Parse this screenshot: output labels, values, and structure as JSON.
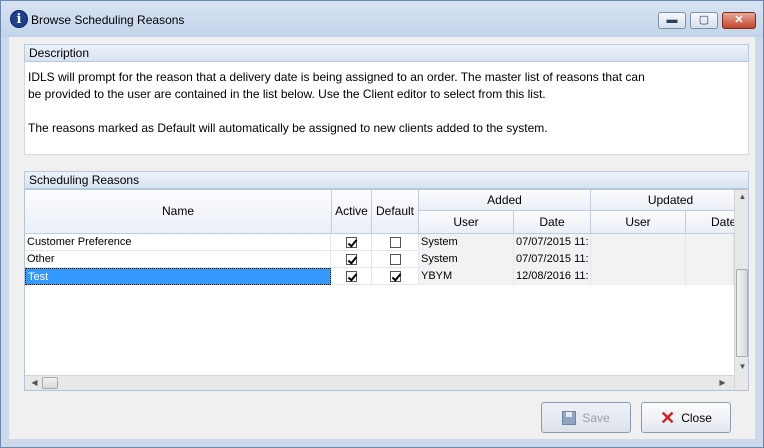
{
  "window": {
    "title": "Browse Scheduling Reasons",
    "app_icon_glyph": "i",
    "controls": {
      "minimize": "▬",
      "maximize": "▢",
      "close": "✕"
    }
  },
  "description": {
    "header": "Description",
    "lines": [
      "IDLS will prompt for the reason that a delivery date is being assigned to an order.  The master list of reasons that can",
      "be provided to the user are contained in the list below.  Use the Client editor to select from this  list.",
      "The reasons marked as Default will automatically be assigned to new clients added to the system."
    ]
  },
  "grid": {
    "header": "Scheduling Reasons",
    "columns": {
      "name": "Name",
      "active": "Active",
      "default": "Default",
      "added": "Added",
      "updated": "Updated",
      "added_user": "User",
      "added_date": "Date",
      "updated_user": "User",
      "updated_date": "Date"
    },
    "rows": [
      {
        "name": "Customer Preference",
        "active": true,
        "default": false,
        "added_user": "System",
        "added_date": "07/07/2015 11:",
        "updated_user": "",
        "updated_date": ""
      },
      {
        "name": "Other",
        "active": true,
        "default": false,
        "added_user": "System",
        "added_date": "07/07/2015 11:",
        "updated_user": "",
        "updated_date": ""
      },
      {
        "name": "Test",
        "active": true,
        "default": true,
        "added_user": "YBYM",
        "added_date": "12/08/2016 11:",
        "updated_user": "",
        "updated_date": ""
      }
    ],
    "selected_row": 2,
    "scroll": {
      "up": "▲",
      "down": "▼",
      "left": "◀",
      "right": "▶"
    }
  },
  "buttons": {
    "save": {
      "label": "Save",
      "enabled": false,
      "icon": "floppy-disk-icon"
    },
    "close": {
      "label": "Close",
      "enabled": true,
      "icon": "close-x-icon",
      "x_glyph": "✕"
    }
  }
}
